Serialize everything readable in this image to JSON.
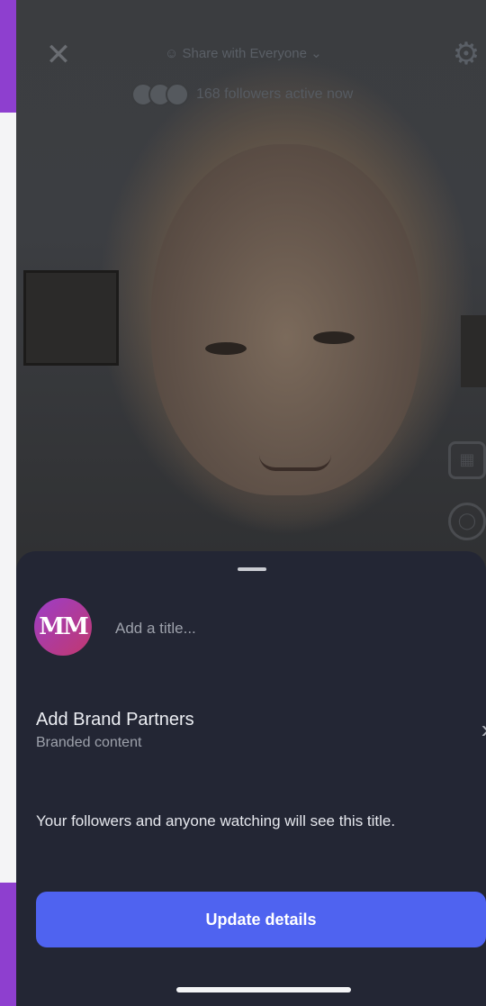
{
  "topbar": {
    "close_icon": "close-icon",
    "share_label": "Share with Everyone",
    "settings_icon": "gear-icon"
  },
  "followers_text": "168 followers active now",
  "sheet": {
    "title_placeholder": "Add a title...",
    "logo_text": "MM",
    "brand_partners": {
      "title": "Add Brand Partners",
      "subtitle": "Branded content"
    },
    "info_text": "Your followers and anyone watching will see this title.",
    "update_button": "Update details"
  },
  "colors": {
    "accent": "#4f63f0",
    "sheet_bg": "#232634",
    "logo_gradient_start": "#9c3ec8",
    "logo_gradient_end": "#c2386e"
  }
}
